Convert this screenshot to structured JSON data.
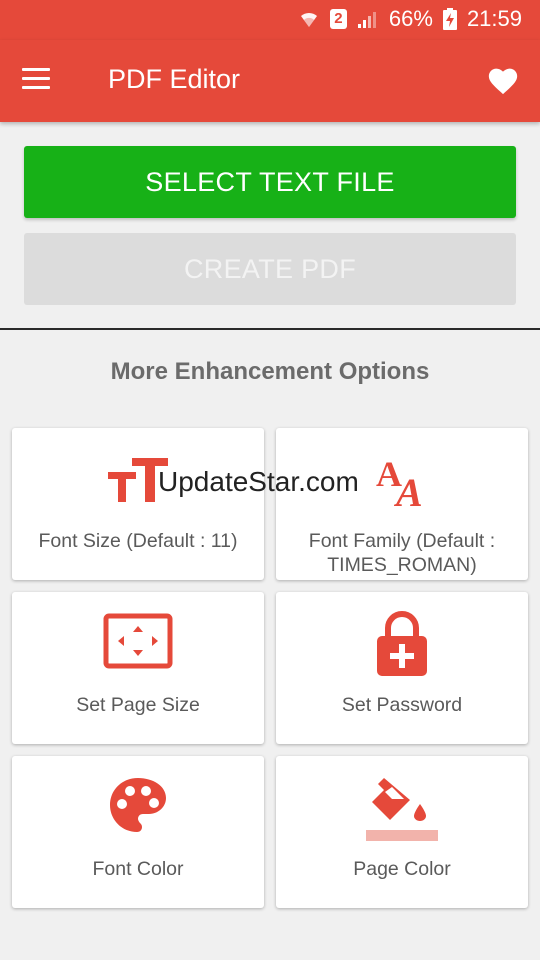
{
  "status_bar": {
    "battery": "66%",
    "time": "21:59",
    "sim_slot": "2"
  },
  "app_bar": {
    "title": "PDF Editor"
  },
  "buttons": {
    "select_text_file": "SELECT TEXT FILE",
    "create_pdf": "CREATE PDF"
  },
  "section_title": "More Enhancement Options",
  "options": [
    {
      "label": "Font Size (Default : 11)",
      "icon": "font-size-icon"
    },
    {
      "label": "Font Family (Default : TIMES_ROMAN)",
      "icon": "font-family-icon"
    },
    {
      "label": "Set Page Size",
      "icon": "page-size-icon"
    },
    {
      "label": "Set Password",
      "icon": "lock-icon"
    },
    {
      "label": "Font Color",
      "icon": "palette-icon"
    },
    {
      "label": "Page Color",
      "icon": "paint-bucket-icon"
    }
  ],
  "watermark": "UpdateStar.com",
  "colors": {
    "accent": "#e5493a",
    "primary_button": "#17b117",
    "disabled_button": "#dcdcdc",
    "icon": "#e5493a",
    "page_color_bar": "#f2b3ab"
  }
}
